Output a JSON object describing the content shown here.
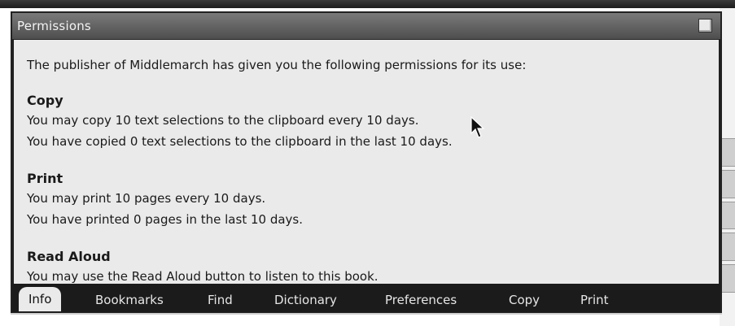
{
  "window": {
    "title": "Permissions"
  },
  "content": {
    "intro": "The publisher of Middlemarch has given you the following permissions for its use:",
    "sections": [
      {
        "heading": "Copy",
        "lines": [
          "You may copy 10 text selections to the clipboard every 10 days.",
          "You have copied 0 text selections to the clipboard in the last 10 days."
        ]
      },
      {
        "heading": "Print",
        "lines": [
          "You may print 10 pages every 10 days.",
          "You have printed 0 pages in the last 10 days."
        ]
      },
      {
        "heading": "Read Aloud",
        "lines": [
          "You may use the Read Aloud button to listen to this book."
        ]
      }
    ]
  },
  "tabs": [
    {
      "label": "Info"
    },
    {
      "label": "Bookmarks"
    },
    {
      "label": "Find"
    },
    {
      "label": "Dictionary"
    },
    {
      "label": "Preferences"
    },
    {
      "label": "Copy"
    },
    {
      "label": "Print"
    }
  ]
}
